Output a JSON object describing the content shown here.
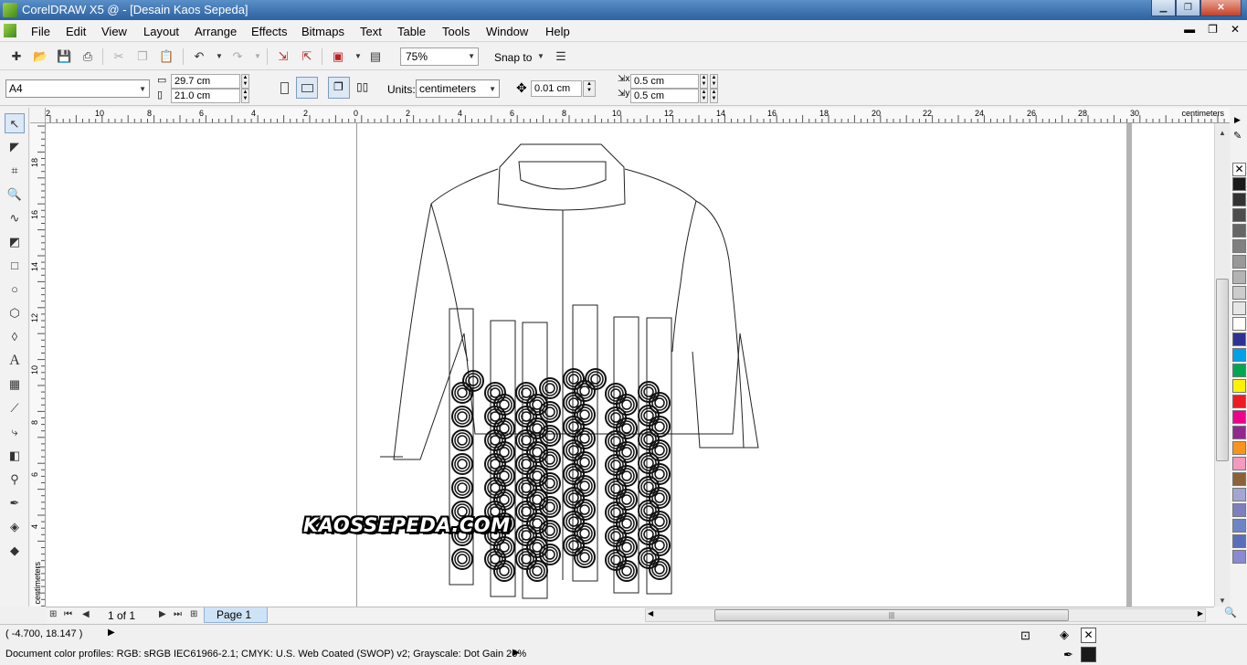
{
  "window": {
    "title": "CorelDRAW X5 @ - [Desain Kaos Sepeda]",
    "minimize": "▁",
    "restore": "❐",
    "close": "✕"
  },
  "menu": {
    "items": [
      "File",
      "Edit",
      "View",
      "Layout",
      "Arrange",
      "Effects",
      "Bitmaps",
      "Text",
      "Table",
      "Tools",
      "Window",
      "Help"
    ],
    "doc_controls": [
      "▬",
      "❐",
      "✕"
    ]
  },
  "toolbar": {
    "zoom": "75%",
    "snap_to": "Snap to"
  },
  "property_bar": {
    "paper_size": "A4",
    "page_width": "29.7 cm",
    "page_height": "21.0 cm",
    "units_label": "Units:",
    "units_value": "centimeters",
    "nudge": "0.01 cm",
    "dup_x": "0.5 cm",
    "dup_y": "0.5 cm"
  },
  "ruler": {
    "h_ticks": [
      "2",
      "10",
      "8",
      "6",
      "4",
      "2",
      "0",
      "2",
      "4",
      "6",
      "8",
      "10",
      "12",
      "14",
      "16",
      "18",
      "20",
      "22",
      "24",
      "26",
      "28",
      "30"
    ],
    "v_ticks": [
      "18",
      "16",
      "14",
      "12",
      "10",
      "8",
      "6",
      "4"
    ],
    "units": "centimeters"
  },
  "canvas": {
    "watermark": "KAOSSEPEDA.COM"
  },
  "page_nav": {
    "page_count": "1 of 1",
    "page_tab": "Page 1"
  },
  "status": {
    "coordinates": "( -4.700, 18.147 )",
    "color_profiles": "Document color profiles: RGB: sRGB IEC61966-2.1; CMYK: U.S. Web Coated (SWOP) v2; Grayscale: Dot Gain 20%"
  },
  "palette": {
    "colors": [
      "#1a1a1a",
      "#333333",
      "#4d4d4d",
      "#666666",
      "#808080",
      "#999999",
      "#b3b3b3",
      "#cccccc",
      "#e6e6e6",
      "#ffffff",
      "#2e3192",
      "#00a0e9",
      "#00a651",
      "#fff200",
      "#ed1c24",
      "#ec008c",
      "#92278f",
      "#f7941d",
      "#f49ac1",
      "#8c6239",
      "#a5a5d2",
      "#7f7fc0",
      "#6e85c5",
      "#5b6fb8",
      "#8a8ad0"
    ]
  },
  "fill": {
    "fill_color": "#ffffff",
    "outline_color": "#1a1a1a"
  }
}
